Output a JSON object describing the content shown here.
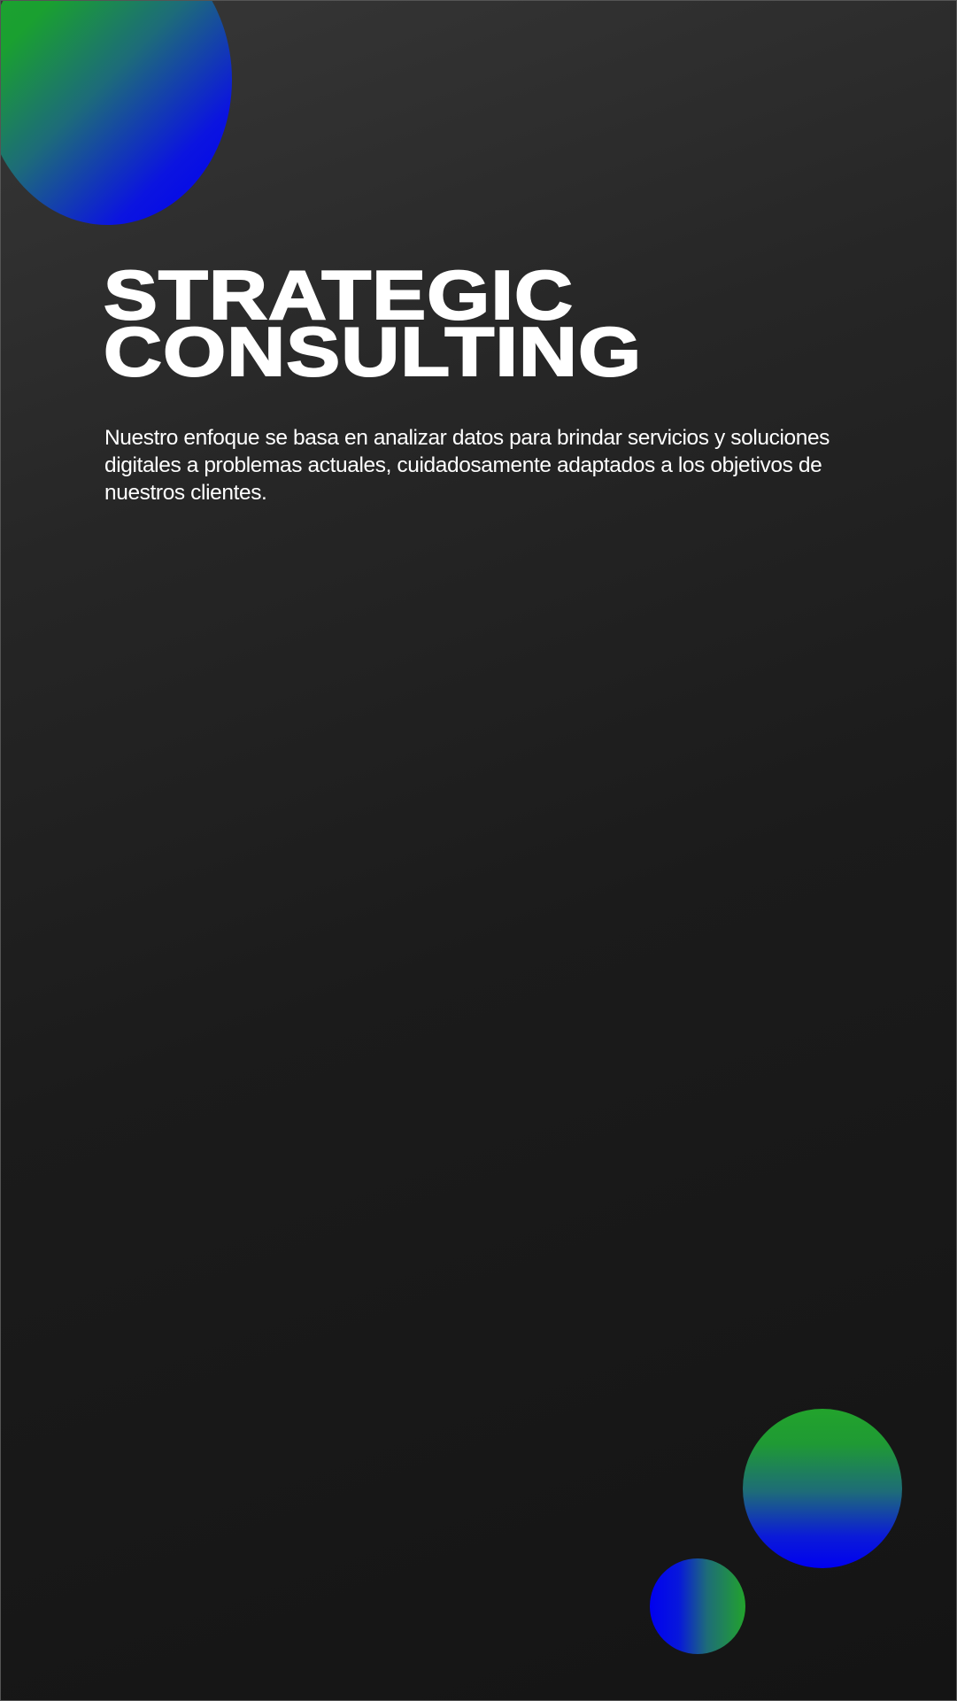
{
  "headline": {
    "line1": "STRATEGIC",
    "line2": "CONSULTING"
  },
  "description": "Nuestro enfoque se basa en analizar datos para brindar servicios y soluciones digitales a problemas actuales, cuidadosamente adaptados a los objetivos de nuestros clientes.",
  "colors": {
    "background": "#1a1a1a",
    "green": "#22a32c",
    "blue": "#0000f0",
    "text": "#ffffff"
  }
}
